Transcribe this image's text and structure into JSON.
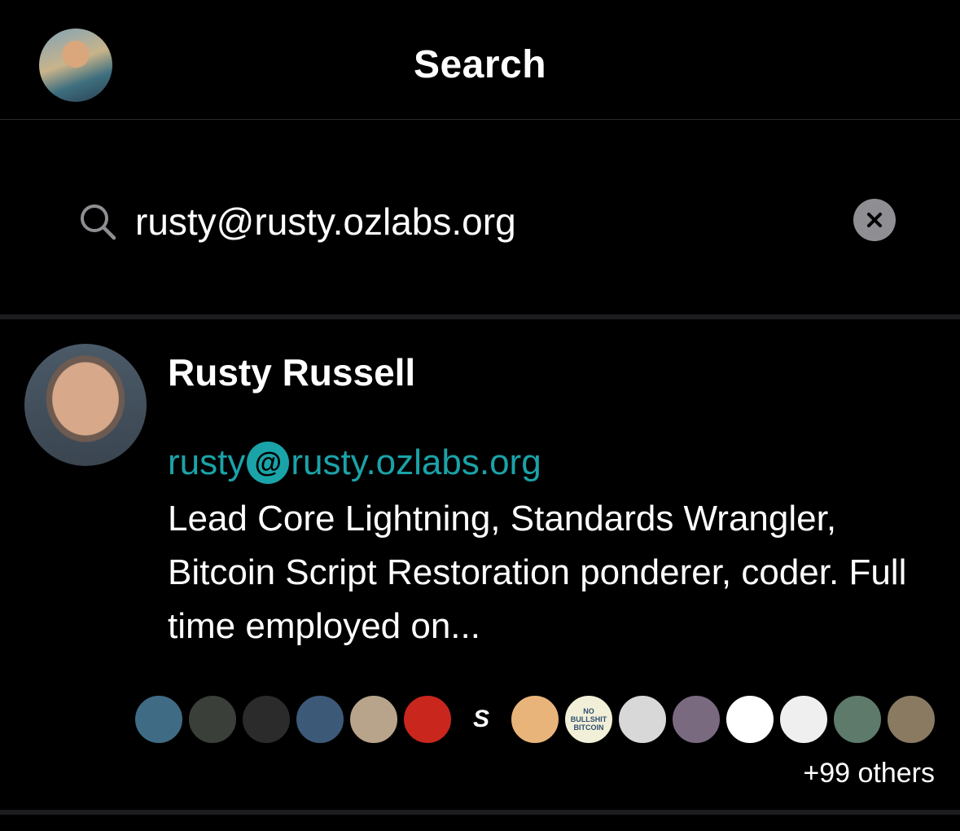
{
  "header": {
    "title": "Search"
  },
  "search": {
    "value": "rusty@rusty.ozlabs.org",
    "clear_icon": "close-icon"
  },
  "result": {
    "name": "Rusty Russell",
    "nip05_user": "rusty",
    "nip05_at": "@",
    "nip05_domain": "rusty.ozlabs.org",
    "bio": "Lead Core Lightning, Standards Wrangler, Bitcoin Script Restoration ponderer, coder. Full time employed on...",
    "followers": [
      {
        "color": "#3f6b85",
        "label": ""
      },
      {
        "color": "#3b3f3a",
        "label": ""
      },
      {
        "color": "#2b2b2b",
        "label": ""
      },
      {
        "color": "#3c5a78",
        "label": ""
      },
      {
        "color": "#b8a48a",
        "label": ""
      },
      {
        "color": "#c9261d",
        "label": ""
      },
      {
        "color": "#000000",
        "label": "S"
      },
      {
        "color": "#e8b47a",
        "label": ""
      },
      {
        "color": "#f2efd8",
        "label": "NO BULLSHIT BITCOIN"
      },
      {
        "color": "#d8d8d8",
        "label": ""
      },
      {
        "color": "#7a6a80",
        "label": ""
      },
      {
        "color": "#ffffff",
        "label": ""
      },
      {
        "color": "#efefef",
        "label": ""
      },
      {
        "color": "#5e7a6b",
        "label": ""
      },
      {
        "color": "#8a7a62",
        "label": ""
      }
    ],
    "others": "+99 others"
  }
}
